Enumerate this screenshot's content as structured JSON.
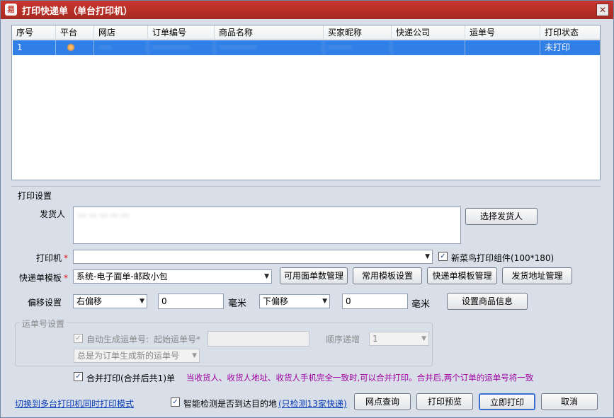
{
  "window": {
    "icon_glyph": "易",
    "title": "打印快递单（单台打印机）",
    "close_glyph": "✕"
  },
  "table": {
    "columns": [
      "序号",
      "平台",
      "网店",
      "订单编号",
      "商品名称",
      "买家昵称",
      "快递公司",
      "运单号",
      "打印状态"
    ],
    "rows": [
      {
        "seq": "1",
        "platform": "platform-icon",
        "shop": "·····",
        "order_no": "··············",
        "product": "··············",
        "buyer": "·········",
        "courier": "",
        "waybill": "",
        "status": "未打印"
      }
    ]
  },
  "print_settings": {
    "section_title": "打印设置",
    "sender_label": "发货人",
    "sender_value": "··· ··· ··· ··· ···",
    "choose_sender_button": "选择发货人",
    "printer_label": "打印机",
    "printer_value": "",
    "cainiao_label": "新菜鸟打印组件(100*180)",
    "cainiao_checked": true,
    "template_label": "快递单模板",
    "template_value": "系统-电子面单-邮政小包",
    "btn_available_count": "可用面单数管理",
    "btn_common_template": "常用模板设置",
    "btn_template_manage": "快递单模板管理",
    "btn_ship_address": "发货地址管理",
    "offset_label": "偏移设置",
    "offset_h_dir": "右偏移",
    "offset_h_value": "0",
    "offset_unit_1": "毫米",
    "offset_v_dir": "下偏移",
    "offset_v_value": "0",
    "offset_unit_2": "毫米",
    "btn_product_info": "设置商品信息"
  },
  "waybill_settings": {
    "group_title": "运单号设置",
    "auto_generate_label": "自动生成运单号:",
    "auto_generate_checked": true,
    "start_no_label": "起始运单号",
    "start_no_value": "",
    "sequence_label": "顺序递增",
    "sequence_value": "1",
    "generate_mode": "总是为订单生成新的运单号"
  },
  "merge": {
    "label": "合并打印(合并后共1)单",
    "checked": true,
    "notice": "当收货人、收货人地址、收货人手机完全一致时,可以合并打印。合并后,两个订单的运单号将一致"
  },
  "footer": {
    "switch_link": "切换到多台打印机同时打印模式",
    "smart_check_label": "智能检测是否到达目的地",
    "smart_check_checked": true,
    "smart_check_link": "(只检测13家快递)",
    "btn_outlet_query": "网点查询",
    "btn_preview": "打印预览",
    "btn_print_now": "立即打印",
    "btn_cancel": "取消"
  },
  "colors": {
    "title_bar": "#b42e26",
    "selected_row": "#2f7fe6",
    "window_bg": "#d9dfe9",
    "notice_text": "#a000a0",
    "link_text": "#0b3db5"
  }
}
